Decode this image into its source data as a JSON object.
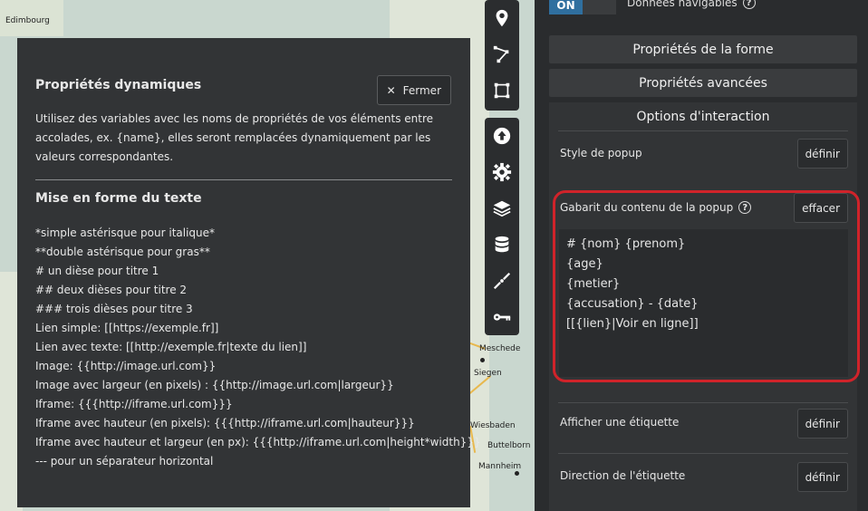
{
  "map": {
    "cities": [
      "Edimbourg",
      "Meschede",
      "Siegen",
      "Wiesbaden",
      "Buttelborn",
      "Mannheim"
    ]
  },
  "toolbar": {
    "top_icons": [
      "marker-icon",
      "polyline-icon",
      "polygon-icon"
    ],
    "bottom_icons": [
      "upload-icon",
      "gear-icon",
      "layers-icon",
      "database-icon",
      "split-icon",
      "key-icon"
    ]
  },
  "help": {
    "title": "Propriétés dynamiques",
    "close_label": "Fermer",
    "intro": "Utilisez des variables avec les noms de propriétés de vos éléments entre accolades, ex. {name}, elles seront remplacées dynamiquement par les valeurs correspondantes.",
    "format_title": "Mise en forme du texte",
    "rules": [
      "*simple astérisque pour italique*",
      "**double astérisque pour gras**",
      "# un dièse pour titre 1",
      "## deux dièses pour titre 2",
      "### trois dièses pour titre 3",
      "Lien simple: [[https://exemple.fr]]",
      "Lien avec texte: [[http://exemple.fr|texte du lien]]",
      "Image: {{http://image.url.com}}",
      "Image avec largeur (en pixels) : {{http://image.url.com|largeur}}",
      "Iframe: {{{http://iframe.url.com}}}",
      "Iframe avec hauteur (en pixels): {{{http://iframe.url.com|hauteur}}}",
      "Iframe avec hauteur et largeur (en px): {{{http://iframe.url.com|height*width}}}",
      "--- pour un séparateur horizontal"
    ]
  },
  "panel": {
    "toggle_on": "ON",
    "navigable_label": "Données navigables",
    "section_shape": "Propriétés de la forme",
    "section_advanced": "Propriétés avancées",
    "section_interaction": "Options d'interaction",
    "popup_style_label": "Style de popup",
    "define_label": "définir",
    "template_label": "Gabarit du contenu de la popup",
    "clear_label": "effacer",
    "template_text": "# {nom} {prenom}\n{age}\n{metier}\n{accusation} - {date}\n[[{lien}|Voir en ligne]]",
    "show_label_label": "Afficher une étiquette",
    "label_direction_label": "Direction de l'étiquette"
  },
  "colors": {
    "highlight_border": "#d0232a",
    "toggle_on_bg": "#2f6f9f"
  }
}
